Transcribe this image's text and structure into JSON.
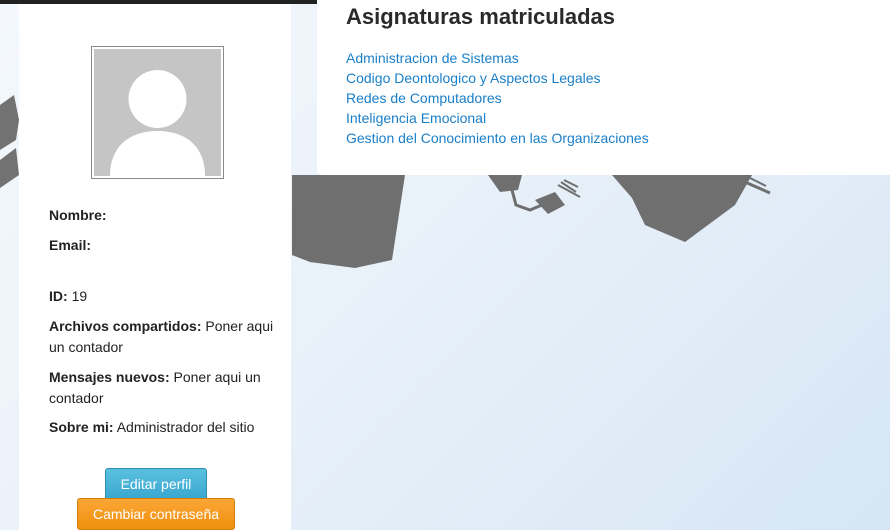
{
  "profile": {
    "name_label": "Nombre:",
    "name_value": "",
    "email_label": "Email:",
    "email_value": "",
    "id_label": "ID:",
    "id_value": "19",
    "files_label": "Archivos compartidos:",
    "files_value": "Poner aqui un contador",
    "messages_label": "Mensajes nuevos:",
    "messages_value": "Poner aqui un contador",
    "about_label": "Sobre mi:",
    "about_value": "Administrador del sitio"
  },
  "buttons": {
    "edit_profile": "Editar perfil",
    "change_password": "Cambiar contraseña"
  },
  "subjects": {
    "title": "Asignaturas matriculadas",
    "items": [
      "Administracion de Sistemas",
      "Codigo Deontologico y Aspectos Legales",
      "Redes de Computadores",
      "Inteligencia Emocional",
      "Gestion del Conocimiento en las Organizaciones"
    ]
  },
  "colors": {
    "link": "#1a7fc9",
    "edit_button": "#39a7d1",
    "password_button": "#f0900f",
    "background_art": "#6f6f6f"
  },
  "icons": {
    "avatar": "default-user-silhouette",
    "background": "graduation-caps"
  }
}
